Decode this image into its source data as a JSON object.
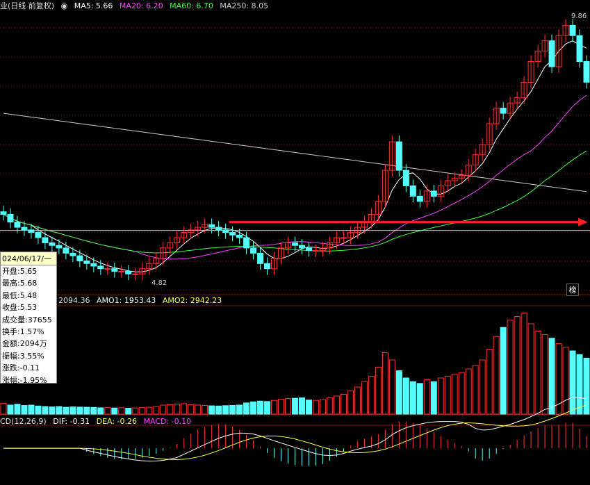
{
  "header": {
    "title": "业(日线 前复权)",
    "indicator_toggle_icon": "circle-chevron-down-icon",
    "ma5": "MA5: 5.66",
    "ma20": "MA20: 6.20",
    "ma60": "MA60: 6.70",
    "ma250": "MA250: 8.05"
  },
  "price_labels": {
    "high": "9.86",
    "low": "4.82"
  },
  "volume_legend": {
    "vol": "2094.36",
    "amo1": "AMO1: 1953.43",
    "amo2": "AMO2: 2942.23"
  },
  "macd_legend": {
    "name": "CD(12,26,9)",
    "dif": "DIF: -0.31",
    "dea": "DEA: -0.26",
    "macd": "MACD: -0.10"
  },
  "tooltip": {
    "date": "024/06/17/一",
    "rows": [
      "开盘:5.65",
      "最高:5.68",
      "最低:5.48",
      "收盘:5.53",
      "成交量:37655",
      "换手:1.57%",
      "金额:2094万",
      "振幅:3.55%",
      "涨跌:-0.11",
      "涨幅:-1.95%"
    ]
  },
  "badge": "榜",
  "colors": {
    "up": "#ff3232",
    "down": "#54ffff",
    "ma5": "#ffffff",
    "ma20": "#ff40ff",
    "ma60": "#40ff40",
    "ma250": "#cccccc",
    "arrow": "#ff2020",
    "grid": "#801010"
  },
  "chart_data": {
    "type": "candlestick",
    "y_range": [
      4.5,
      10.0
    ],
    "marked_low": 4.82,
    "marked_high": 9.86,
    "support_level": 5.9,
    "n": 85,
    "closes": [
      6.05,
      5.9,
      5.8,
      5.75,
      5.7,
      5.6,
      5.5,
      5.45,
      5.4,
      5.3,
      5.25,
      5.15,
      5.1,
      5.05,
      5.0,
      5.0,
      4.95,
      4.95,
      4.9,
      4.9,
      5.0,
      5.1,
      5.2,
      5.4,
      5.5,
      5.6,
      5.7,
      5.75,
      5.8,
      5.85,
      5.8,
      5.75,
      5.7,
      5.65,
      5.6,
      5.4,
      5.3,
      5.1,
      5.0,
      5.2,
      5.4,
      5.5,
      5.45,
      5.4,
      5.35,
      5.35,
      5.4,
      5.5,
      5.6,
      5.6,
      5.7,
      5.8,
      5.9,
      6.05,
      6.3,
      6.9,
      7.45,
      6.9,
      6.6,
      6.4,
      6.3,
      6.5,
      6.4,
      6.6,
      6.7,
      6.75,
      6.8,
      7.0,
      7.2,
      7.4,
      7.8,
      8.1,
      8.0,
      8.2,
      8.3,
      8.6,
      9.0,
      9.2,
      9.4,
      8.9,
      9.5,
      9.7,
      9.5,
      9.0,
      8.6
    ],
    "volume_range": [
      0,
      6000
    ],
    "volumes": [
      600,
      500,
      550,
      480,
      500,
      450,
      420,
      400,
      420,
      380,
      400,
      390,
      380,
      370,
      350,
      360,
      340,
      350,
      330,
      340,
      360,
      380,
      420,
      500,
      520,
      560,
      580,
      520,
      500,
      480,
      460,
      450,
      470,
      480,
      500,
      620,
      680,
      720,
      700,
      760,
      820,
      860,
      880,
      900,
      780,
      760,
      800,
      900,
      1000,
      1100,
      1300,
      1500,
      1800,
      2100,
      2600,
      3400,
      3000,
      2400,
      2000,
      1800,
      1700,
      1900,
      1800,
      2000,
      2100,
      2200,
      2300,
      2500,
      2700,
      3000,
      3600,
      4300,
      4800,
      5200,
      5400,
      5600,
      5000,
      4600,
      4400,
      4200,
      3900,
      3700,
      3500,
      3300,
      3100
    ],
    "macd_range": [
      -0.8,
      0.5
    ]
  }
}
